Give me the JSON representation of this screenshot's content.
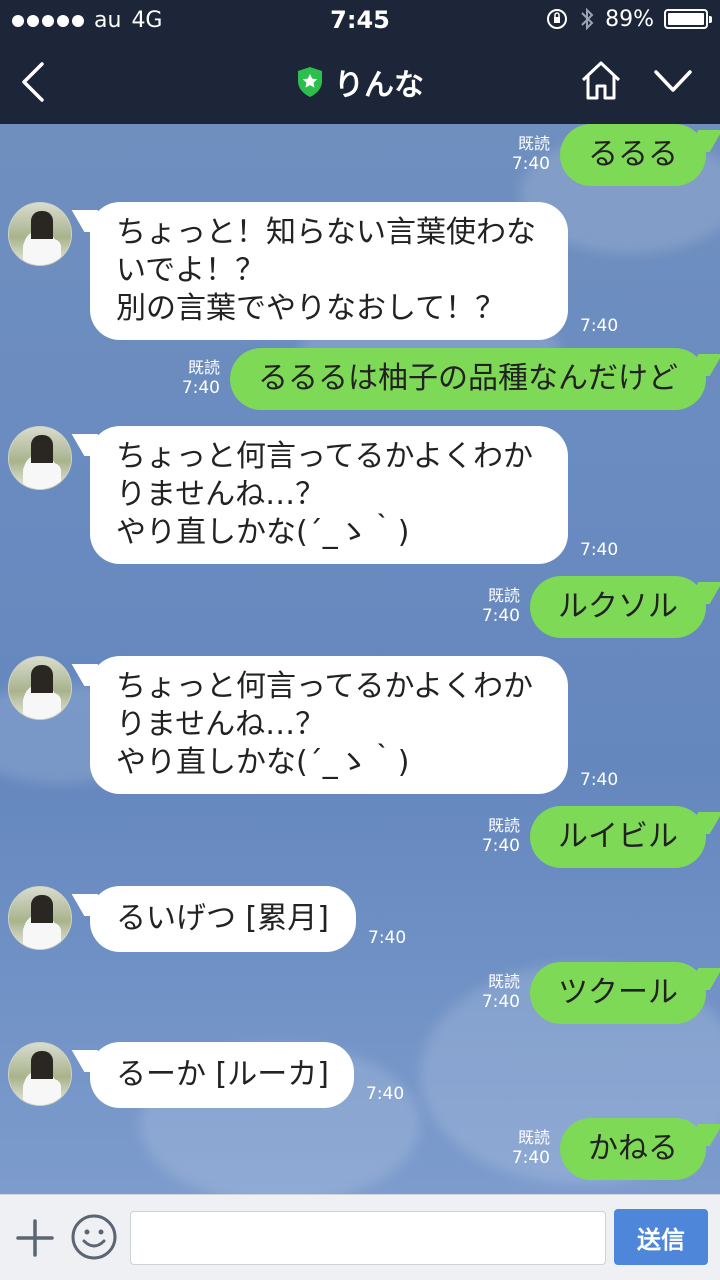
{
  "status_bar": {
    "carrier": "au",
    "network": "4G",
    "time": "7:45",
    "battery_text": "89%",
    "battery_level": 0.89
  },
  "header": {
    "title": "りんな"
  },
  "messages": [
    {
      "side": "sent",
      "text": "るるる",
      "read": "既読",
      "time": "7:40"
    },
    {
      "side": "recv",
      "lines": [
        "ちょっと！知らない言葉使わな",
        "いでよ！？",
        "別の言葉でやりなおして！？"
      ],
      "time": "7:40"
    },
    {
      "side": "sent",
      "text": "るるるは柚子の品種なんだけど",
      "read": "既読",
      "time": "7:40"
    },
    {
      "side": "recv",
      "lines": [
        "ちょっと何言ってるかよくわか",
        "りませんね…？",
        "やり直しかな(´_ゝ｀)"
      ],
      "time": "7:40"
    },
    {
      "side": "sent",
      "text": "ルクソル",
      "read": "既読",
      "time": "7:40"
    },
    {
      "side": "recv",
      "lines": [
        "ちょっと何言ってるかよくわか",
        "りませんね…？",
        "やり直しかな(´_ゝ｀)"
      ],
      "time": "7:40"
    },
    {
      "side": "sent",
      "text": "ルイビル",
      "read": "既読",
      "time": "7:40"
    },
    {
      "side": "recv",
      "lines": [
        "るいげつ [累月]"
      ],
      "time": "7:40"
    },
    {
      "side": "sent",
      "text": "ツクール",
      "read": "既読",
      "time": "7:40"
    },
    {
      "side": "recv",
      "lines": [
        "るーか [ルーカ]"
      ],
      "time": "7:40"
    },
    {
      "side": "sent",
      "text": "かねる",
      "read": "既読",
      "time": "7:40"
    }
  ],
  "input": {
    "placeholder": "",
    "send_label": "送信"
  }
}
